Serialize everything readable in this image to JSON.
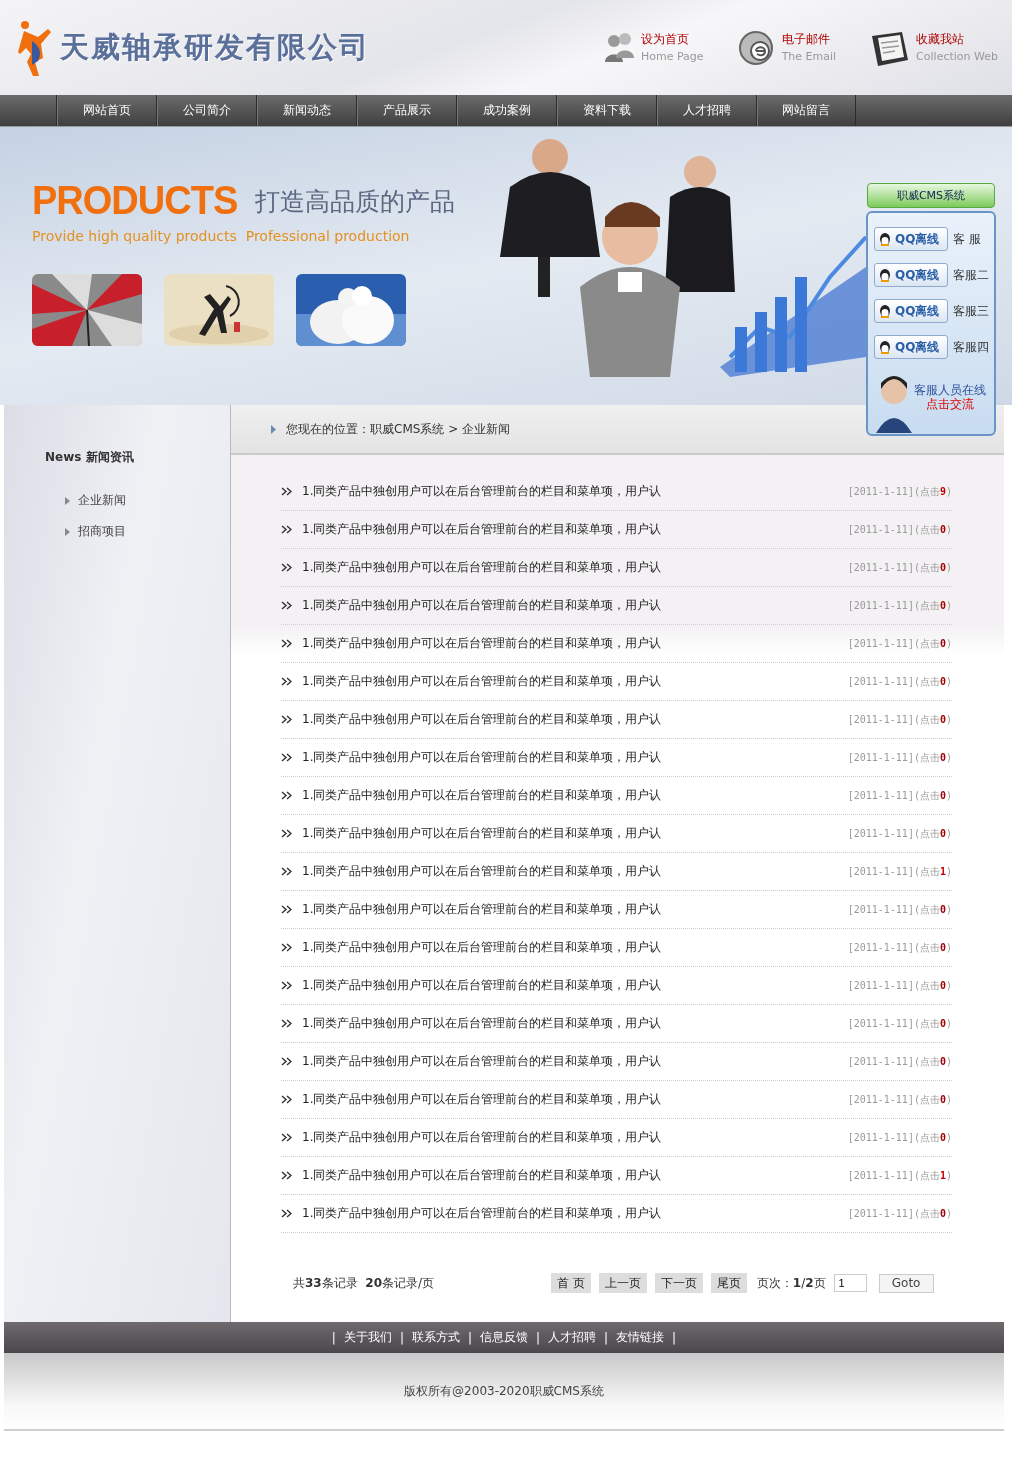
{
  "header": {
    "company": "天威轴承研发有限公司",
    "links": [
      {
        "label": "设为首页",
        "sublabel": "Home Page",
        "kind": "home"
      },
      {
        "label": "电子邮件",
        "sublabel": "The Email",
        "kind": "email"
      },
      {
        "label": "收藏我站",
        "sublabel": "Collection Web",
        "kind": "favorite"
      }
    ]
  },
  "nav": [
    {
      "label": "网站首页"
    },
    {
      "label": "公司简介"
    },
    {
      "label": "新闻动态"
    },
    {
      "label": "产品展示"
    },
    {
      "label": "成功案例"
    },
    {
      "label": "资料下载"
    },
    {
      "label": "人才招聘"
    },
    {
      "label": "网站留言"
    }
  ],
  "banner": {
    "heading": "PRODUCTS",
    "slogan": "打造高品质的产品",
    "tagline": "Provide high quality products  Professional production"
  },
  "qq_panel": {
    "title": "职威CMS系统",
    "items": [
      {
        "badge": "QQ离线",
        "name": "客 服"
      },
      {
        "badge": "QQ离线",
        "name": "客服二"
      },
      {
        "badge": "QQ离线",
        "name": "客服三"
      },
      {
        "badge": "QQ离线",
        "name": "客服四"
      }
    ],
    "contact": "客服人员在线",
    "action": "点击交流"
  },
  "sidebar": {
    "title": "News 新闻资讯",
    "items": [
      {
        "label": "企业新闻"
      },
      {
        "label": "招商项目"
      }
    ]
  },
  "breadcrumb": "您现在的位置：职威CMS系统 > 企业新闻",
  "meta_open": "(",
  "meta_close": ")",
  "news": [
    {
      "title": "1.同类产品中独创用户可以在后台管理前台的栏目和菜单项，用户认",
      "date": "[2011-1-11]",
      "clicks_label": "点击",
      "clicks": "9"
    },
    {
      "title": "1.同类产品中独创用户可以在后台管理前台的栏目和菜单项，用户认",
      "date": "[2011-1-11]",
      "clicks_label": "点击",
      "clicks": "0"
    },
    {
      "title": "1.同类产品中独创用户可以在后台管理前台的栏目和菜单项，用户认",
      "date": "[2011-1-11]",
      "clicks_label": "点击",
      "clicks": "0"
    },
    {
      "title": "1.同类产品中独创用户可以在后台管理前台的栏目和菜单项，用户认",
      "date": "[2011-1-11]",
      "clicks_label": "点击",
      "clicks": "0"
    },
    {
      "title": "1.同类产品中独创用户可以在后台管理前台的栏目和菜单项，用户认",
      "date": "[2011-1-11]",
      "clicks_label": "点击",
      "clicks": "0"
    },
    {
      "title": "1.同类产品中独创用户可以在后台管理前台的栏目和菜单项，用户认",
      "date": "[2011-1-11]",
      "clicks_label": "点击",
      "clicks": "0"
    },
    {
      "title": "1.同类产品中独创用户可以在后台管理前台的栏目和菜单项，用户认",
      "date": "[2011-1-11]",
      "clicks_label": "点击",
      "clicks": "0"
    },
    {
      "title": "1.同类产品中独创用户可以在后台管理前台的栏目和菜单项，用户认",
      "date": "[2011-1-11]",
      "clicks_label": "点击",
      "clicks": "0"
    },
    {
      "title": "1.同类产品中独创用户可以在后台管理前台的栏目和菜单项，用户认",
      "date": "[2011-1-11]",
      "clicks_label": "点击",
      "clicks": "0"
    },
    {
      "title": "1.同类产品中独创用户可以在后台管理前台的栏目和菜单项，用户认",
      "date": "[2011-1-11]",
      "clicks_label": "点击",
      "clicks": "0"
    },
    {
      "title": "1.同类产品中独创用户可以在后台管理前台的栏目和菜单项，用户认",
      "date": "[2011-1-11]",
      "clicks_label": "点击",
      "clicks": "1"
    },
    {
      "title": "1.同类产品中独创用户可以在后台管理前台的栏目和菜单项，用户认",
      "date": "[2011-1-11]",
      "clicks_label": "点击",
      "clicks": "0"
    },
    {
      "title": "1.同类产品中独创用户可以在后台管理前台的栏目和菜单项，用户认",
      "date": "[2011-1-11]",
      "clicks_label": "点击",
      "clicks": "0"
    },
    {
      "title": "1.同类产品中独创用户可以在后台管理前台的栏目和菜单项，用户认",
      "date": "[2011-1-11]",
      "clicks_label": "点击",
      "clicks": "0"
    },
    {
      "title": "1.同类产品中独创用户可以在后台管理前台的栏目和菜单项，用户认",
      "date": "[2011-1-11]",
      "clicks_label": "点击",
      "clicks": "0"
    },
    {
      "title": "1.同类产品中独创用户可以在后台管理前台的栏目和菜单项，用户认",
      "date": "[2011-1-11]",
      "clicks_label": "点击",
      "clicks": "0"
    },
    {
      "title": "1.同类产品中独创用户可以在后台管理前台的栏目和菜单项，用户认",
      "date": "[2011-1-11]",
      "clicks_label": "点击",
      "clicks": "0"
    },
    {
      "title": "1.同类产品中独创用户可以在后台管理前台的栏目和菜单项，用户认",
      "date": "[2011-1-11]",
      "clicks_label": "点击",
      "clicks": "0"
    },
    {
      "title": "1.同类产品中独创用户可以在后台管理前台的栏目和菜单项，用户认",
      "date": "[2011-1-11]",
      "clicks_label": "点击",
      "clicks": "1"
    },
    {
      "title": "1.同类产品中独创用户可以在后台管理前台的栏目和菜单项，用户认",
      "date": "[2011-1-11]",
      "clicks_label": "点击",
      "clicks": "0"
    }
  ],
  "pagination": {
    "summary": "共**33**条记录  **20**条记录/页",
    "buttons": [
      {
        "label": "首 页"
      },
      {
        "label": "上一页"
      },
      {
        "label": "下一页"
      },
      {
        "label": "尾页"
      }
    ],
    "page_info": "页次：**1**/**2**页",
    "page_input": "1",
    "goto": "Goto"
  },
  "footer": {
    "separator": "|",
    "links": [
      {
        "label": "关于我们"
      },
      {
        "label": "联系方式"
      },
      {
        "label": "信息反馈"
      },
      {
        "label": "人才招聘"
      },
      {
        "label": "友情链接"
      }
    ],
    "copyright": "版权所有@2003-2020职威CMS系统"
  }
}
